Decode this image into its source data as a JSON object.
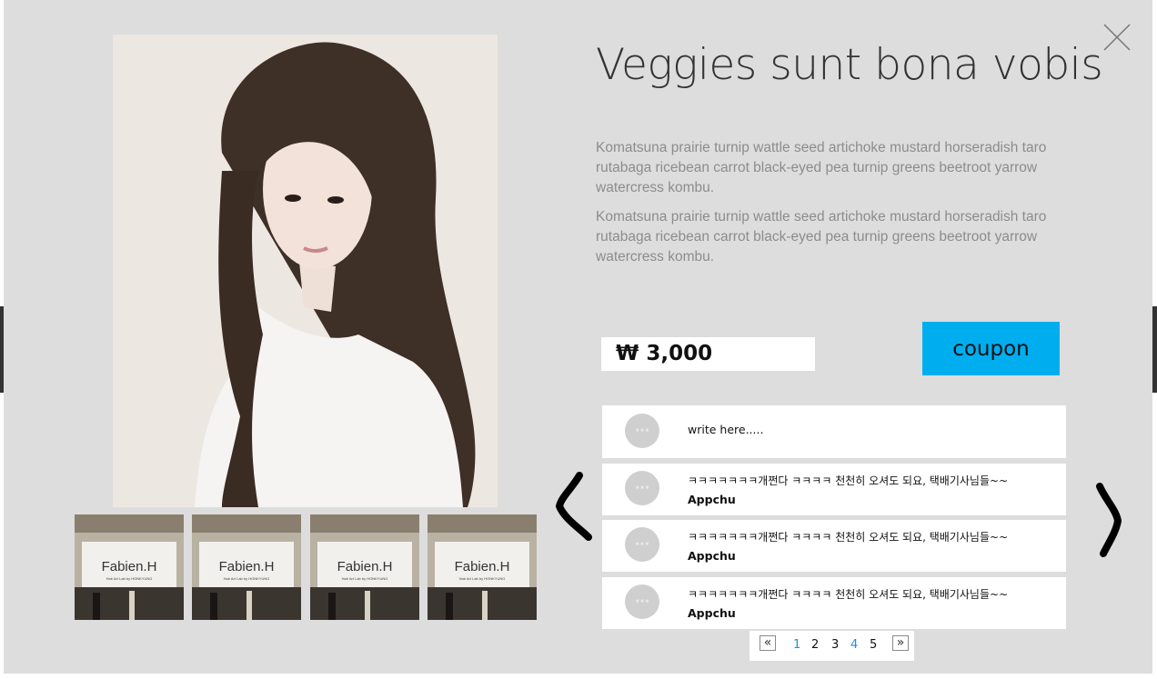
{
  "title": "Veggies sunt bona vobis",
  "description": [
    "Komatsuna prairie turnip wattle seed artichoke mustard horseradish taro rutabaga ricebean carrot black-eyed pea turnip greens beetroot yarrow watercress kombu.",
    "Komatsuna prairie turnip wattle seed artichoke mustard horseradish taro rutabaga ricebean carrot black-eyed pea turnip greens beetroot yarrow watercress kombu."
  ],
  "price": "₩ 3,000",
  "coupon_label": "coupon",
  "thumbnails": [
    {
      "sign": "Fabien.H",
      "sub": "Hair Art Lab by HONKYUNG"
    },
    {
      "sign": "Fabien.H",
      "sub": "Hair Art Lab by HONKYUNG"
    },
    {
      "sign": "Fabien.H",
      "sub": "Hair Art Lab by HONKYUNG"
    },
    {
      "sign": "Fabien.H",
      "sub": "Hair Art Lab by HONKYUNG"
    }
  ],
  "comment_input": {
    "placeholder": "write here....."
  },
  "comments": [
    {
      "text": "ㅋㅋㅋㅋㅋㅋㅋ개쩐다 ㅋㅋㅋㅋ 천천히 오셔도 되요, 택배기사님들~~",
      "author": "Appchu"
    },
    {
      "text": "ㅋㅋㅋㅋㅋㅋㅋ개쩐다 ㅋㅋㅋㅋ 천천히 오셔도 되요, 택배기사님들~~",
      "author": "Appchu"
    },
    {
      "text": "ㅋㅋㅋㅋㅋㅋㅋ개쩐다 ㅋㅋㅋㅋ 천천히 오셔도 되요, 택배기사님들~~",
      "author": "Appchu"
    }
  ],
  "pagination": {
    "prev": "«",
    "next": "»",
    "pages": [
      {
        "label": "1",
        "color": "#1f8fd8"
      },
      {
        "label": "2",
        "color": "#111111"
      },
      {
        "label": "3",
        "color": "#111111"
      },
      {
        "label": "4",
        "color": "#1f8fd8"
      },
      {
        "label": "5",
        "color": "#111111"
      }
    ]
  },
  "icons": {
    "close": "close-icon",
    "prev": "chevron-left-icon",
    "next": "chevron-right-icon",
    "avatar": "avatar-placeholder-icon"
  },
  "colors": {
    "modal_bg": "#dddddd",
    "accent": "#00aeef",
    "page_active": "#1f8fd8"
  }
}
